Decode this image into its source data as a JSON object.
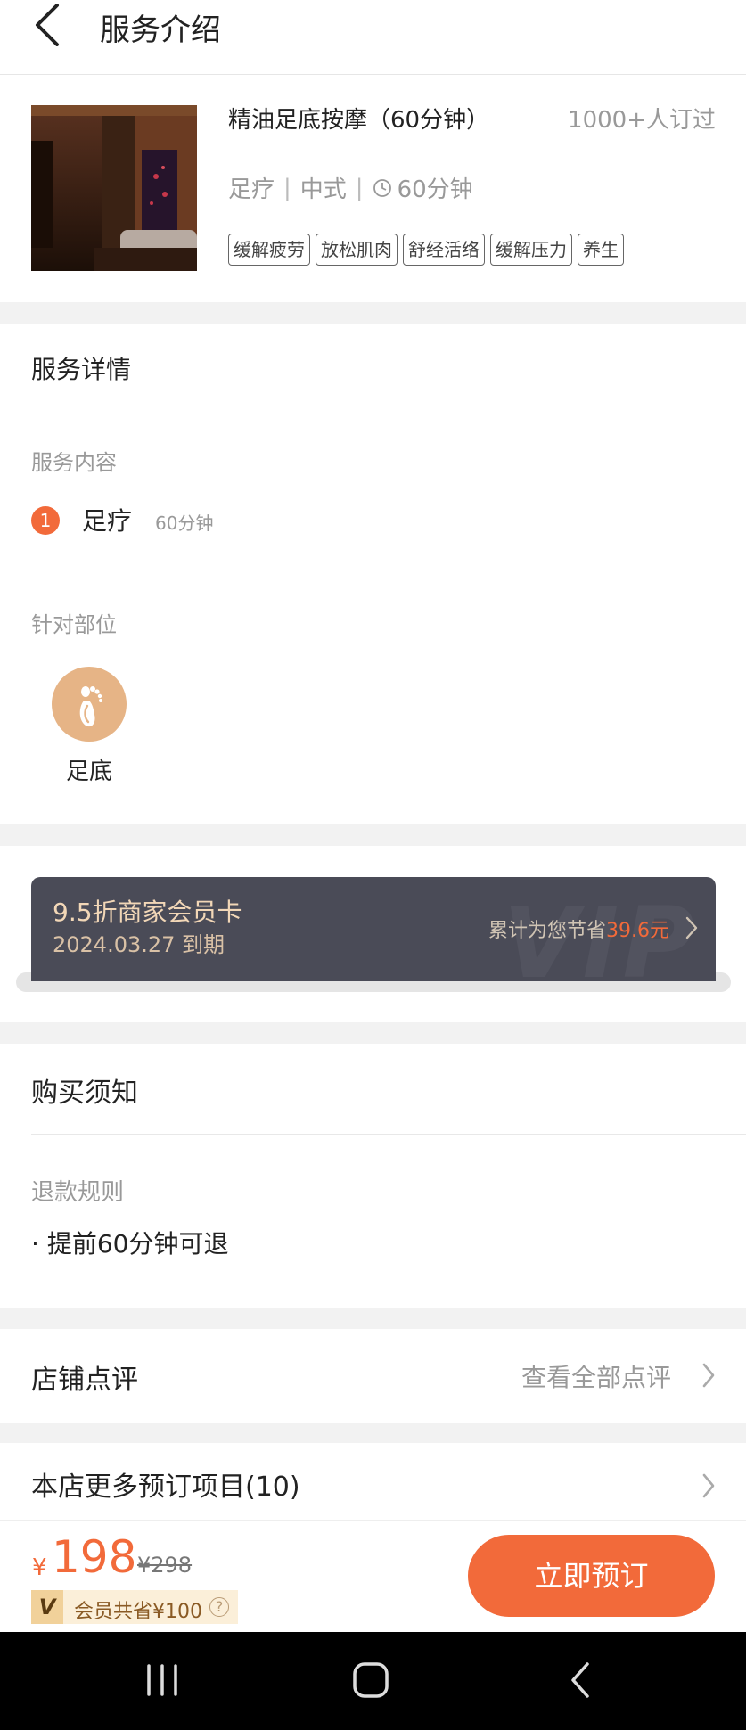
{
  "header": {
    "title": "服务介绍"
  },
  "product": {
    "name": "精油足底按摩（60分钟）",
    "sold": "1000+人订过",
    "category": "足疗",
    "style": "中式",
    "duration": "60分钟",
    "tags": [
      "缓解疲劳",
      "放松肌肉",
      "舒经活络",
      "缓解压力",
      "养生"
    ]
  },
  "detail": {
    "title": "服务详情",
    "content_label": "服务内容",
    "item_index": "1",
    "item_name": "足疗",
    "item_duration": "60分钟",
    "target_label": "针对部位",
    "target_name": "足底"
  },
  "member_card": {
    "name": "9.5折商家会员卡",
    "expiry": "2024.03.27 到期",
    "save_prefix": "累计为您节省",
    "save_amount": "39.6元",
    "watermark": "VIP"
  },
  "notice": {
    "title": "购买须知",
    "refund_label": "退款规则",
    "refund_item": "提前60分钟可退"
  },
  "reviews": {
    "title": "店铺点评",
    "link": "查看全部点评"
  },
  "more": {
    "title": "本店更多预订项目(10)"
  },
  "bottom": {
    "currency": "¥",
    "price": "198",
    "old_price": "¥298",
    "member_save_text": "会员共省¥100",
    "help_symbol": "?",
    "book_label": "立即预订"
  },
  "colors": {
    "accent": "#f26a3a",
    "card_bg": "#4a4b57",
    "foot_circle": "#e6b486"
  }
}
